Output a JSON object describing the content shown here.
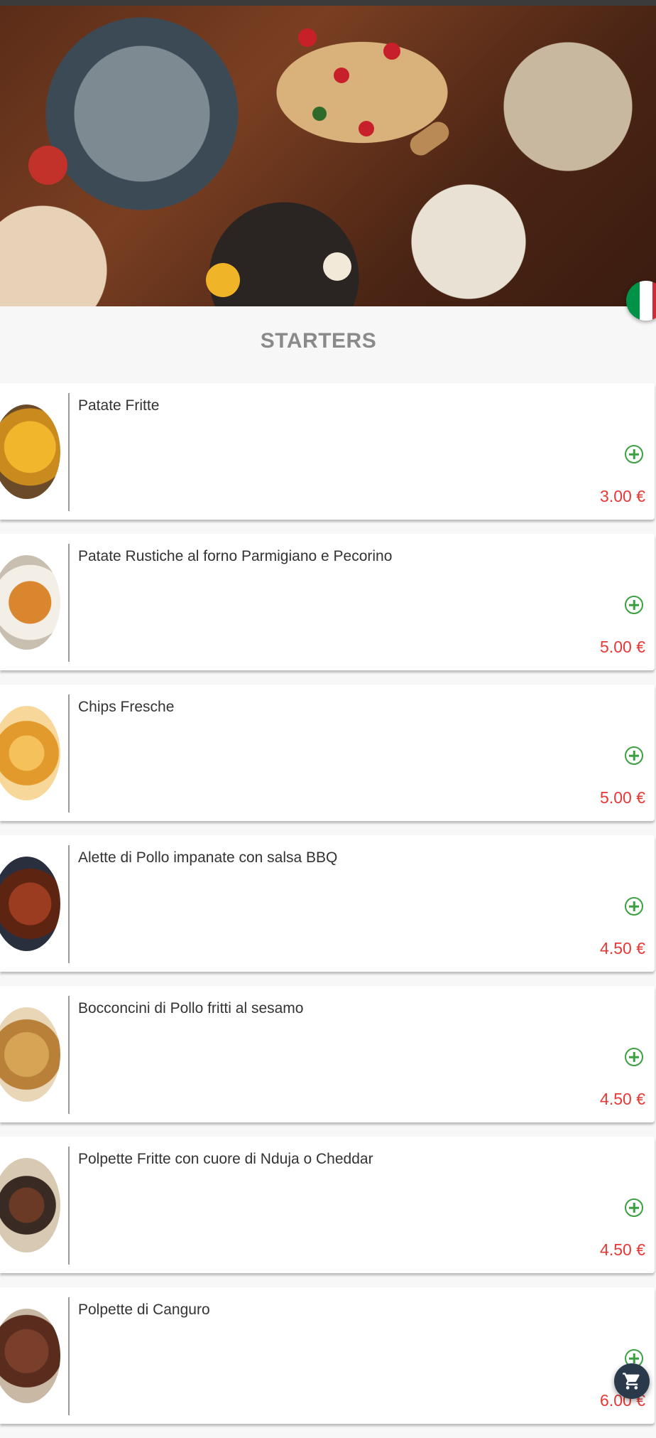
{
  "section": {
    "title": "STARTERS"
  },
  "items": [
    {
      "name": "Patate Fritte",
      "price": "3.00 €",
      "icon": "fries-image"
    },
    {
      "name": "Patate Rustiche al forno Parmigiano e Pecorino",
      "price": "5.00 €",
      "icon": "baked-potatoes-image"
    },
    {
      "name": "Chips Fresche",
      "price": "5.00 €",
      "icon": "chips-image"
    },
    {
      "name": "Alette di Pollo impanate con salsa BBQ",
      "price": "4.50 €",
      "icon": "chicken-wings-image"
    },
    {
      "name": "Bocconcini di Pollo fritti al sesamo",
      "price": "4.50 €",
      "icon": "chicken-bites-image"
    },
    {
      "name": "Polpette Fritte con cuore di Nduja o Cheddar",
      "price": "4.50 €",
      "icon": "meatballs-image"
    },
    {
      "name": "Polpette di Canguro",
      "price": "6.00 €",
      "icon": "kangaroo-meatballs-image"
    }
  ],
  "language": {
    "icon": "italian-flag-icon",
    "colors": [
      "#009246",
      "#ffffff",
      "#ce2b37"
    ]
  },
  "cart": {
    "icon": "shopping-cart-icon"
  },
  "colors": {
    "price": "#e53935",
    "add": "#3aa041",
    "title": "#8a8a8a",
    "background": "#f7f7f7"
  }
}
